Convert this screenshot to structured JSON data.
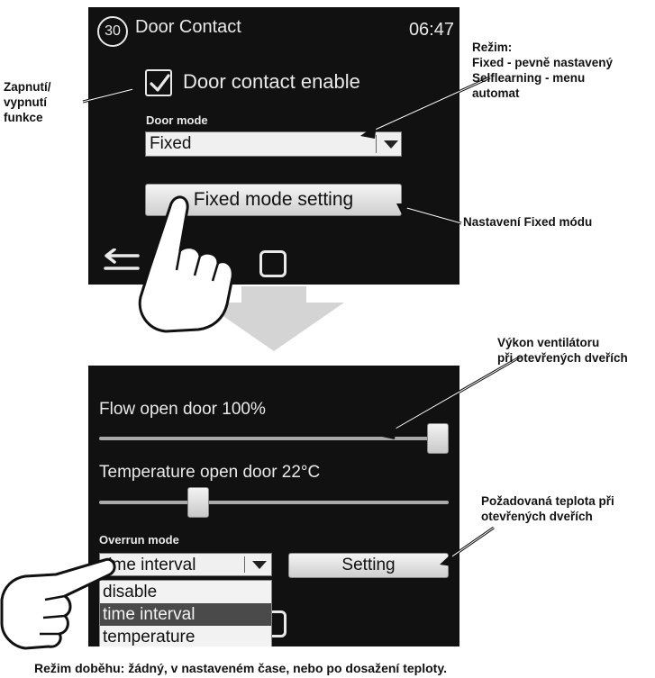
{
  "screen1": {
    "badge": "30",
    "title": "Door Contact",
    "time": "06:47",
    "enable_label": "Door contact enable",
    "enable_checked": true,
    "door_mode_label": "Door mode",
    "door_mode_value": "Fixed",
    "fixed_button_label": "Fixed mode setting",
    "back_icon": "back-arrow-icon",
    "home_icon": "home-square-icon"
  },
  "screen2": {
    "flow_label": "Flow open door 100%",
    "flow_level": 1.0,
    "temp_label": "Temperature open door 22°C",
    "temp_level": 0.27,
    "overrun_label": "Overrun mode",
    "overrun_value": "time interval",
    "setting_button_label": "Setting",
    "overrun_options": [
      "disable",
      "time interval",
      "temperature"
    ],
    "overrun_selected_index": 1
  },
  "callouts": {
    "toggle": [
      "Zapnutí/",
      "vypnutí",
      "funkce"
    ],
    "mode": [
      "Režim:",
      "Fixed - pevně nastavený",
      "Selflearning - menu",
      "automat"
    ],
    "fixed": "Nastavení Fixed módu",
    "flow": [
      "Výkon ventilátoru",
      "při otevřených dveřích"
    ],
    "temp": [
      "Požadovaná teplota při",
      "otevřených dveřích"
    ],
    "overrun": "Režim doběhu: žádný, v nastaveném čase, nebo po dosažení teploty."
  },
  "colors": {
    "screen_bg": "#111111",
    "screen_text": "#e9e9e9",
    "control_bg": "#f0f0f0",
    "selected_option_bg": "#4a4a4a",
    "arrow_gray": "#d4d4d4"
  }
}
